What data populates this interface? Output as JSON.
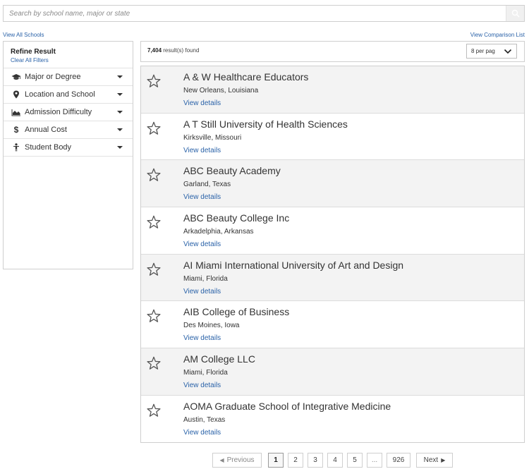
{
  "search": {
    "placeholder": "Search by school name, major or state"
  },
  "links": {
    "view_all": "View All Schools",
    "comparison": "View Comparison List"
  },
  "sidebar": {
    "title": "Refine Result",
    "clear": "Clear All Filters",
    "filters": [
      {
        "label": "Major or Degree",
        "icon": "graduation-cap-icon"
      },
      {
        "label": "Location and School",
        "icon": "map-pin-icon"
      },
      {
        "label": "Admission Difficulty",
        "icon": "area-chart-icon"
      },
      {
        "label": "Annual Cost",
        "icon": "dollar-icon"
      },
      {
        "label": "Student Body",
        "icon": "person-icon"
      }
    ]
  },
  "results": {
    "count": "7,404",
    "suffix": " result(s) found",
    "per_page": "8 per pag"
  },
  "schools": [
    {
      "name": "A & W Healthcare Educators",
      "location": "New Orleans, Louisiana",
      "link": "View details"
    },
    {
      "name": "A T Still University of Health Sciences",
      "location": "Kirksville, Missouri",
      "link": "View details"
    },
    {
      "name": "ABC Beauty Academy",
      "location": "Garland, Texas",
      "link": "View details"
    },
    {
      "name": "ABC Beauty College Inc",
      "location": "Arkadelphia, Arkansas",
      "link": "View details"
    },
    {
      "name": "AI Miami International University of Art and Design",
      "location": "Miami, Florida",
      "link": "View details"
    },
    {
      "name": "AIB College of Business",
      "location": "Des Moines, Iowa",
      "link": "View details"
    },
    {
      "name": "AM College LLC",
      "location": "Miami, Florida",
      "link": "View details"
    },
    {
      "name": "AOMA Graduate School of Integrative Medicine",
      "location": "Austin, Texas",
      "link": "View details"
    }
  ],
  "pagination": {
    "previous": "Previous",
    "next": "Next",
    "pages": [
      "1",
      "2",
      "3",
      "4",
      "5",
      "...",
      "926"
    ],
    "current": "1"
  },
  "colors": {
    "link": "#2a62a8",
    "row_shade": "#f3f3f3",
    "border": "#cfcfcf"
  }
}
